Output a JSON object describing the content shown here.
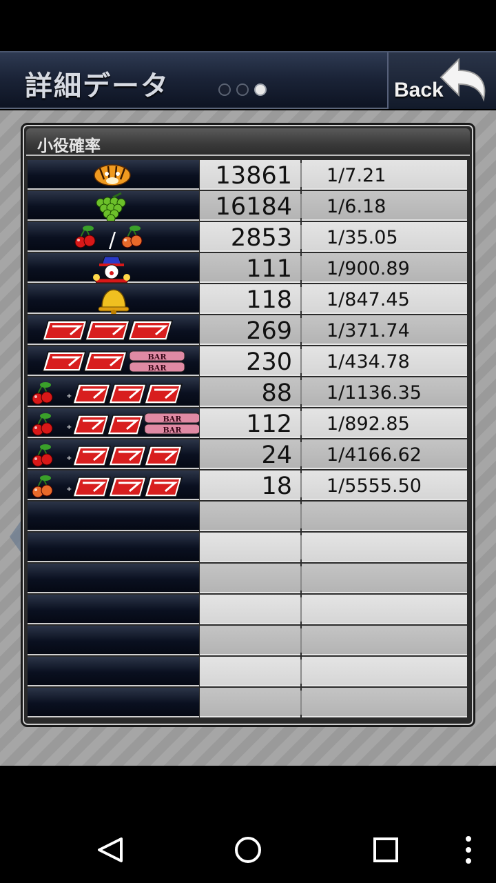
{
  "header": {
    "title": "詳細データ",
    "back_label": "Back",
    "page_dots": [
      false,
      false,
      true
    ]
  },
  "panel": {
    "title": "小役確率"
  },
  "rows": [
    {
      "icon": "tiger-icon",
      "count": "13861",
      "prob": "1/7.21"
    },
    {
      "icon": "grape-icon",
      "count": "16184",
      "prob": "1/6.18"
    },
    {
      "icon": "cherry-cherry-icon",
      "count": "2853",
      "prob": "1/35.05"
    },
    {
      "icon": "clown-icon",
      "count": "111",
      "prob": "1/900.89"
    },
    {
      "icon": "bell-icon",
      "count": "118",
      "prob": "1/847.45"
    },
    {
      "icon": "triple-seven-icon",
      "count": "269",
      "prob": "1/371.74"
    },
    {
      "icon": "seven-seven-bar-icon",
      "count": "230",
      "prob": "1/434.78"
    },
    {
      "icon": "cherry-plus-triple-seven-icon",
      "count": "88",
      "prob": "1/1136.35"
    },
    {
      "icon": "cherry-plus-seven-bar-icon",
      "count": "112",
      "prob": "1/892.85"
    },
    {
      "icon": "red-cherry-plus-triple-seven-icon",
      "count": "24",
      "prob": "1/4166.62"
    },
    {
      "icon": "orange-cherry-plus-triple-seven-icon",
      "count": "18",
      "prob": "1/5555.50"
    },
    {
      "icon": "",
      "count": "",
      "prob": ""
    },
    {
      "icon": "",
      "count": "",
      "prob": ""
    },
    {
      "icon": "",
      "count": "",
      "prob": ""
    },
    {
      "icon": "",
      "count": "",
      "prob": ""
    },
    {
      "icon": "",
      "count": "",
      "prob": ""
    },
    {
      "icon": "",
      "count": "",
      "prob": ""
    },
    {
      "icon": "",
      "count": "",
      "prob": ""
    }
  ],
  "colors": {
    "seven_red": "#e02020",
    "header_bg": "#1b2438",
    "icon_cell_bg": "#0a1020"
  },
  "navbar": {
    "back": "nav-back-icon",
    "home": "nav-home-icon",
    "recents": "nav-recents-icon",
    "menu": "nav-menu-icon"
  }
}
